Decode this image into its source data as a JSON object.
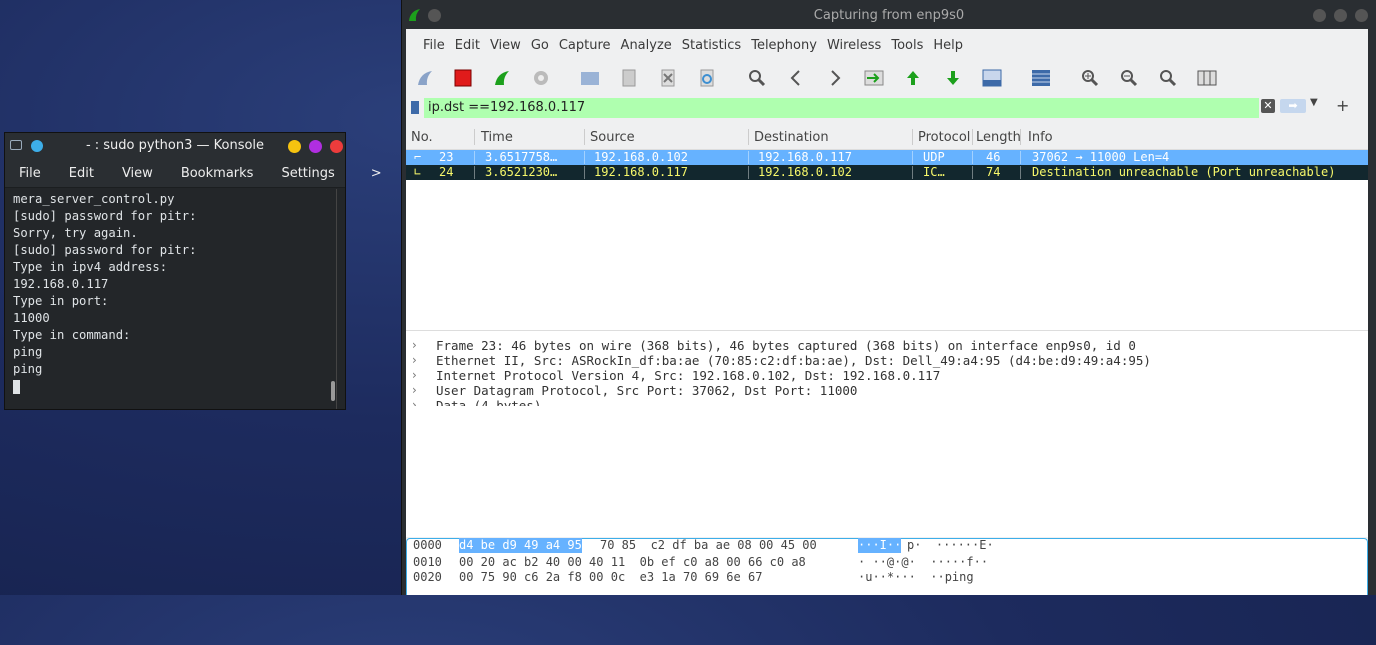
{
  "konsole": {
    "title": "- : sudo python3 — Konsole",
    "menu": [
      "File",
      "Edit",
      "View",
      "Bookmarks",
      "Settings"
    ],
    "more": ">",
    "lines": [
      "mera_server_control.py",
      "[sudo] password for pitr:",
      "Sorry, try again.",
      "[sudo] password for pitr:",
      "Type in ipv4 address:",
      "192.168.0.117",
      "Type in port:",
      "11000",
      "Type in command:",
      "ping",
      "ping"
    ]
  },
  "wireshark": {
    "title": "Capturing from enp9s0",
    "menu": [
      "File",
      "Edit",
      "View",
      "Go",
      "Capture",
      "Analyze",
      "Statistics",
      "Telephony",
      "Wireless",
      "Tools",
      "Help"
    ],
    "filter": "ip.dst ==192.168.0.117",
    "columns": [
      "No.",
      "Time",
      "Source",
      "Destination",
      "Protocol",
      "Length",
      "Info"
    ],
    "packets": [
      {
        "no": "23",
        "time": "3.6517758…",
        "src": "192.168.0.102",
        "dst": "192.168.0.117",
        "proto": "UDP",
        "len": "46",
        "info": "37062 → 11000 Len=4"
      },
      {
        "no": "24",
        "time": "3.6521230…",
        "src": "192.168.0.117",
        "dst": "192.168.0.102",
        "proto": "IC…",
        "len": "74",
        "info": "Destination unreachable (Port unreachable)"
      }
    ],
    "details": [
      "Frame 23: 46 bytes on wire (368 bits), 46 bytes captured (368 bits) on interface enp9s0, id 0",
      "Ethernet II, Src: ASRockIn_df:ba:ae (70:85:c2:df:ba:ae), Dst: Dell_49:a4:95 (d4:be:d9:49:a4:95)",
      "Internet Protocol Version 4, Src: 192.168.0.102, Dst: 192.168.0.117",
      "User Datagram Protocol, Src Port: 37062, Dst Port: 11000",
      "Data (4 bytes)"
    ],
    "bytes": [
      {
        "offset": "0000",
        "hex_hl": "d4 be d9 49 a4 95",
        "hex_rest": "70 85  c2 df ba ae 08 00 45 00",
        "ascii_hl": "···I··",
        "ascii_rest": "p·  ······E·"
      },
      {
        "offset": "0010",
        "hex_hl": "",
        "hex_rest": "00 20 ac b2 40 00 40 11  0b ef c0 a8 00 66 c0 a8",
        "ascii_hl": "",
        "ascii_rest": "· ··@·@·  ·····f··"
      },
      {
        "offset": "0020",
        "hex_hl": "",
        "hex_rest": "00 75 90 c6 2a f8 00 0c  e3 1a 70 69 6e 67",
        "ascii_hl": "",
        "ascii_rest": "·u··*···  ··ping"
      }
    ]
  }
}
